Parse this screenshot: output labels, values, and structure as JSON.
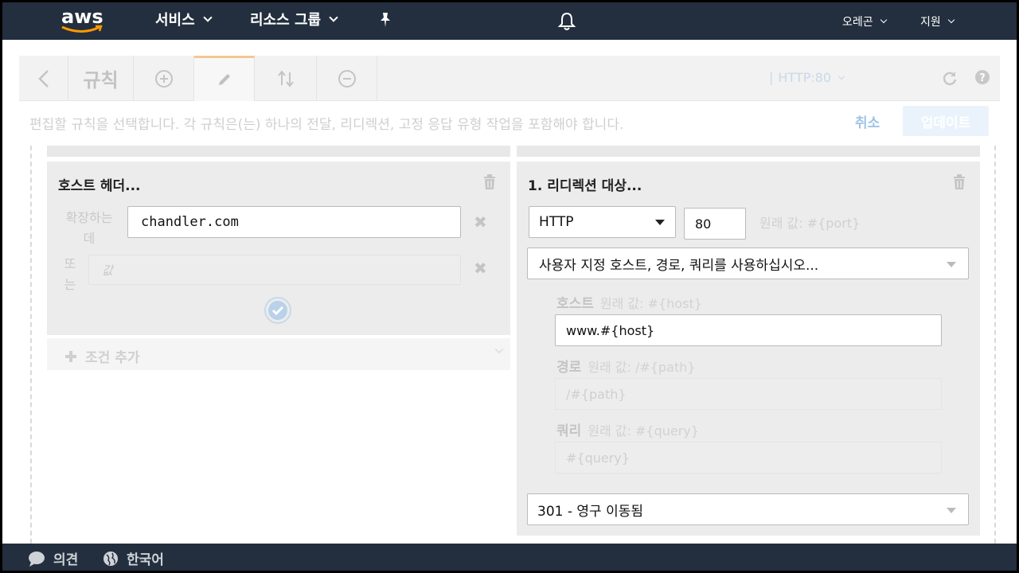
{
  "nav": {
    "logo_text": "aws",
    "services": "서비스",
    "resource_groups": "리소스 그룹",
    "region": "오레곤",
    "support": "지원"
  },
  "toolbar": {
    "title": "규칙",
    "listener": "HTTP:80"
  },
  "instructions": "편집할 규칙을 선택합니다. 각 규칙은(는) 하나의 전달, 리디렉션, 고정 응답 유형 작업을 포함해야 합니다.",
  "buttons": {
    "cancel": "취소",
    "update": "업데이트"
  },
  "condition": {
    "title": "호스트 헤더...",
    "label_line1": "확장하는",
    "label_line2": "데",
    "host_value": "chandler.com",
    "or_line1": "또",
    "or_line2": "는",
    "value_placeholder": "값",
    "add_condition": "조건 추가"
  },
  "action": {
    "title": "1. 리디렉션 대상...",
    "protocol": "HTTP",
    "port": "80",
    "port_hint": "원래 값: #{port}",
    "custom_select": "사용자 지정 호스트, 경로, 쿼리를 사용하십시오...",
    "host_label": "호스트",
    "host_hint": "원래 값: #{host}",
    "host_value": "www.#{host}",
    "path_label": "경로",
    "path_hint": "원래 값: /#{path}",
    "path_value": "/#{path}",
    "query_label": "쿼리",
    "query_hint": "원래 값: #{query}",
    "query_value": "#{query}",
    "status": "301 - 영구 이동됨"
  },
  "footer": {
    "feedback": "의견",
    "language": "한국어"
  },
  "colors": {
    "nav_bg": "#232f3e",
    "accent": "#ff9900",
    "panel_bg": "#ececec"
  }
}
